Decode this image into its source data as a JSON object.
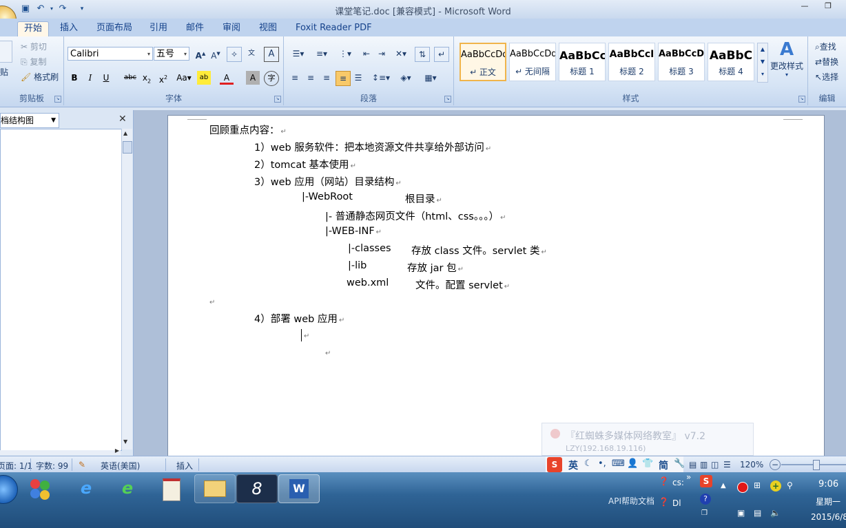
{
  "window": {
    "title": "课堂笔记.doc [兼容模式] - Microsoft Word"
  },
  "tabs": [
    {
      "label": "开始"
    },
    {
      "label": "插入"
    },
    {
      "label": "页面布局"
    },
    {
      "label": "引用"
    },
    {
      "label": "邮件"
    },
    {
      "label": "审阅"
    },
    {
      "label": "视图"
    },
    {
      "label": "Foxit Reader PDF"
    }
  ],
  "clipboard": {
    "cut": "剪切",
    "copy": "复制",
    "format_painter": "格式刷",
    "paste": "贴",
    "label": "剪贴板"
  },
  "font": {
    "name": "Calibri",
    "size": "五号",
    "label": "字体"
  },
  "paragraph": {
    "label": "段落"
  },
  "styles": {
    "items": [
      {
        "sample": "AaBbCcDd",
        "name": "↵ 正文"
      },
      {
        "sample": "AaBbCcDd",
        "name": "↵ 无间隔"
      },
      {
        "sample": "AaBbCc",
        "name": "标题 1"
      },
      {
        "sample": "AaBbCcI",
        "name": "标题 2"
      },
      {
        "sample": "AaBbCcD",
        "name": "标题 3"
      },
      {
        "sample": "AaBbC",
        "name": "标题 4"
      }
    ],
    "change": "更改样式",
    "label": "样式"
  },
  "editing": {
    "find": "查找",
    "replace": "替换",
    "select": "选择",
    "label": "编辑"
  },
  "navpane": {
    "title": "档结构图"
  },
  "document": {
    "lines": [
      "回顾重点内容：",
      "1）web 服务软件：把本地资源文件共享给外部访问",
      "2）tomcat 基本使用",
      "3）web 应用（网站）目录结构",
      "|-WebRoot",
      "根目录",
      "|-  普通静态网页文件（html、css。。。）",
      "|-WEB-INF",
      "|-classes",
      "存放 class 文件。servlet 类",
      "|-lib",
      "存放 jar 包",
      "web.xml",
      "文件。配置 servlet",
      "4）部署 web 应用"
    ],
    "para_mark": "↵"
  },
  "watermark": {
    "title": "『红蜘蛛多媒体网络教室』 v7.2",
    "sub": "LZY(192.168.19.116)"
  },
  "statusbar": {
    "page": "页面: 1/1",
    "words": "字数: 99",
    "language": "英语(美国)",
    "mode": "插入",
    "zoom": "120%",
    "ime_lang": "英",
    "ime_simp": "简"
  },
  "taskbar": {
    "tray_label": "API帮助文档",
    "time": "9:06",
    "weekday": "星期一",
    "date": "2015/6/8",
    "item1": "cs:",
    "item2": "Dl"
  }
}
